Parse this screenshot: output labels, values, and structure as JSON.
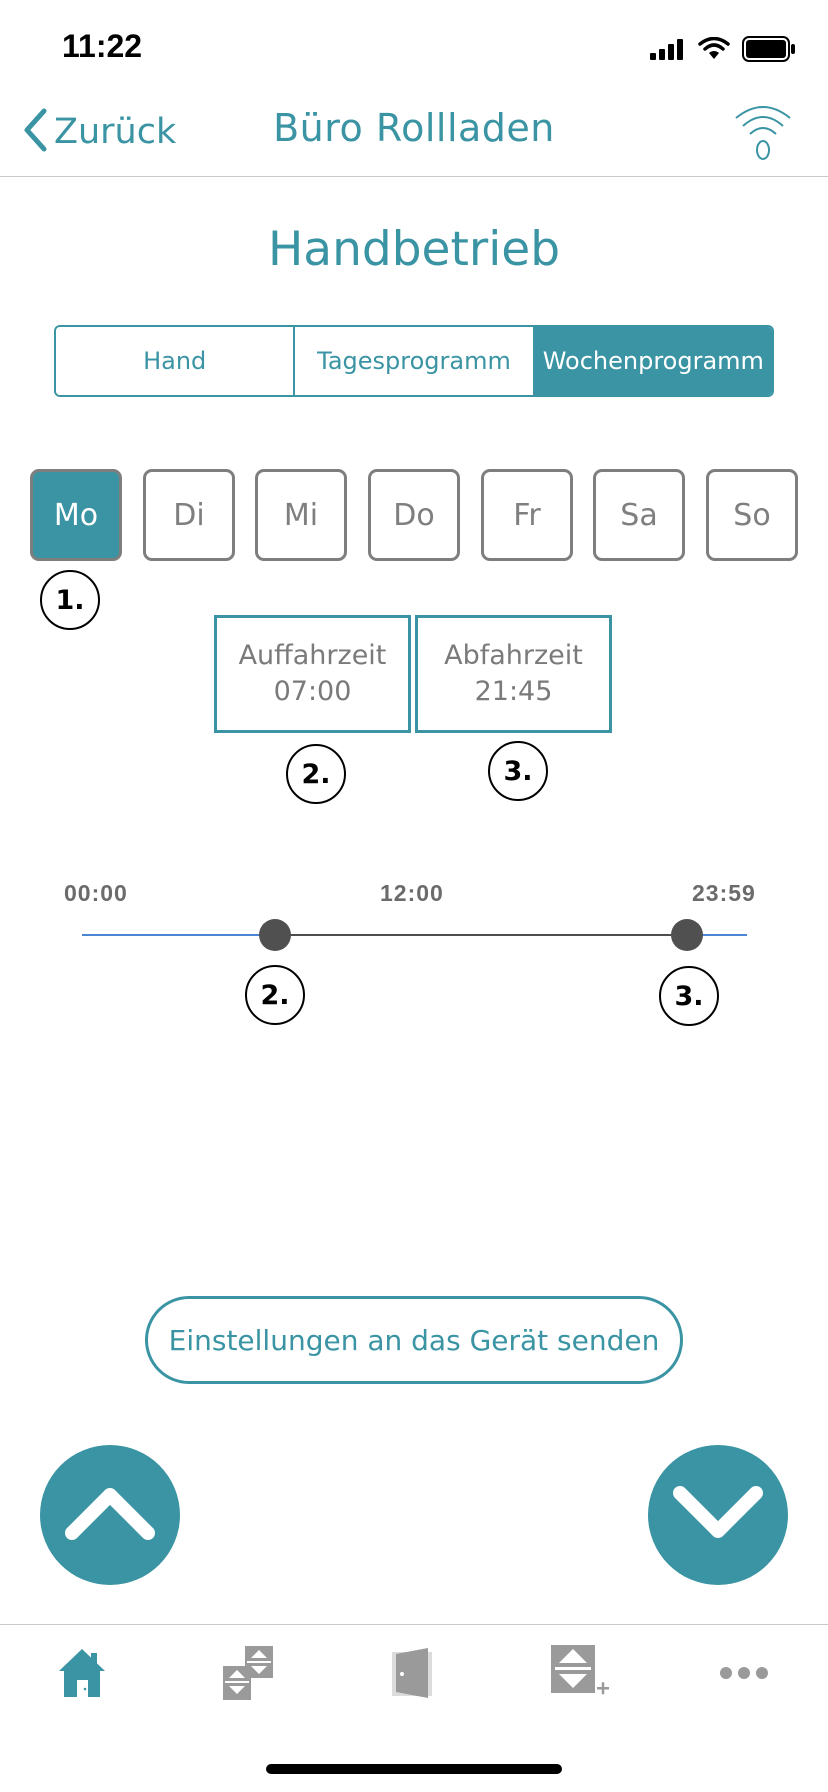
{
  "status_bar": {
    "time": "11:22",
    "icons": [
      "cellular-signal-icon",
      "wifi-icon",
      "battery-icon"
    ]
  },
  "nav": {
    "back_label": "Zurück",
    "title": "Büro Rollladen",
    "signal_icon": "radio-signal-icon"
  },
  "page_title": "Handbetrieb",
  "segments": [
    {
      "label": "Hand",
      "active": false
    },
    {
      "label": "Tagesprogramm",
      "active": false
    },
    {
      "label": "Wochenprogramm",
      "active": true
    }
  ],
  "days": [
    {
      "label": "Mo",
      "active": true
    },
    {
      "label": "Di",
      "active": false
    },
    {
      "label": "Mi",
      "active": false
    },
    {
      "label": "Do",
      "active": false
    },
    {
      "label": "Fr",
      "active": false
    },
    {
      "label": "Sa",
      "active": false
    },
    {
      "label": "So",
      "active": false
    }
  ],
  "markers": {
    "one": "1.",
    "two": "2.",
    "three": "3."
  },
  "times": {
    "up": {
      "label": "Auffahrzeit",
      "value": "07:00"
    },
    "down": {
      "label": "Abfahrzeit",
      "value": "21:45"
    }
  },
  "timeline": {
    "start_label": "00:00",
    "mid_label": "12:00",
    "end_label": "23:59",
    "handle_up_fraction": 0.29,
    "handle_down_fraction": 0.91
  },
  "send_button": "Einstellungen an das Gerät senden",
  "controls": {
    "up_icon": "chevron-up-icon",
    "down_icon": "chevron-down-icon"
  },
  "colors": {
    "accent": "#3a94a3",
    "handle": "#505050",
    "timeline_outer": "#4a86d4",
    "timeline_inner": "#4d4d4d"
  },
  "tabs": [
    {
      "icon": "home-icon",
      "active": true
    },
    {
      "icon": "shutter-group-icon",
      "active": false
    },
    {
      "icon": "door-icon",
      "active": false
    },
    {
      "icon": "add-shutter-icon",
      "active": false
    },
    {
      "icon": "more-icon",
      "active": false
    }
  ]
}
